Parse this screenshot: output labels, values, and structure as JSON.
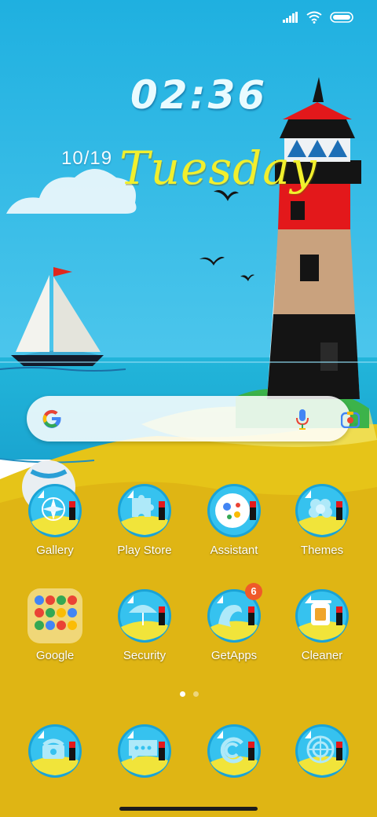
{
  "status_bar": {
    "icons": [
      "signal-icon",
      "wifi-icon",
      "battery-icon"
    ]
  },
  "clock_widget": {
    "time": "02:36",
    "date": "10/19",
    "day": "Tuesday"
  },
  "search_bar": {
    "icons": [
      "google-logo-icon",
      "microphone-icon",
      "lens-icon"
    ]
  },
  "apps": {
    "row1": [
      {
        "label": "Gallery",
        "icon": "compass-icon"
      },
      {
        "label": "Play Store",
        "icon": "puzzle-icon"
      },
      {
        "label": "Assistant",
        "icon": "assistant-icon"
      },
      {
        "label": "Themes",
        "icon": "flower-icon"
      }
    ],
    "row2": [
      {
        "label": "Google",
        "icon": "google-folder-icon"
      },
      {
        "label": "Security",
        "icon": "umbrella-icon"
      },
      {
        "label": "GetApps",
        "icon": "wave-icon",
        "badge": "6"
      },
      {
        "label": "Cleaner",
        "icon": "trash-icon"
      }
    ]
  },
  "dock": {
    "icons": [
      "phone-icon",
      "messages-icon",
      "browser-icon",
      "camera-icon"
    ]
  },
  "page_indicator": {
    "pages": 2,
    "current": 1
  },
  "colors": {
    "sky": "#2bb3e0",
    "sand": "#e8c018",
    "lighthouse_red": "#e3181b",
    "badge": "#ef5a2a"
  }
}
